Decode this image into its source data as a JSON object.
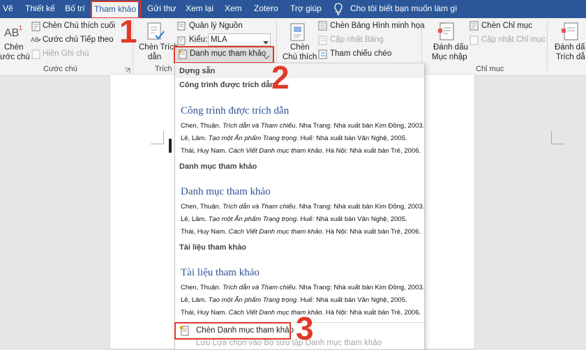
{
  "tabs": [
    "Vẽ",
    "Thiết kế",
    "Bố trí",
    "Tham khảo",
    "Gửi thư",
    "Xem lại",
    "Xem",
    "Zotero",
    "Trợ giúp"
  ],
  "tell_me": "Cho tôi biết bạn muốn làm gì",
  "ribbon": {
    "footnote_btn_line1": "Chèn",
    "footnote_btn_line2": "ước chú",
    "insert_endnote": "Chèn Chú thích cuối",
    "next_footnote": "Cước chú Tiếp theo",
    "show_notes": "Hiện Ghi chú",
    "footnotes_group": "Cước chú",
    "citation_btn_line1": "Chèn Trích",
    "citation_btn_line2": "dẫn",
    "citations_group": "Trích dẫ",
    "manage_sources": "Quản lý Nguồn",
    "style_label": "Kiểu:",
    "style_value": "MLA",
    "bibliography_btn": "Danh mục tham khảo",
    "caption_btn_line1": "Chèn",
    "caption_btn_line2": "Chú thích",
    "insert_table_of_figures": "Chèn Bảng Hình minh họa",
    "update_table": "Cập nhật Bảng",
    "cross_reference": "Tham chiếu chéo",
    "mark_entry_line1": "Đánh dấu",
    "mark_entry_line2": "Mục nhập",
    "insert_index": "Chèn Chỉ mục",
    "update_index": "Cập nhật Chỉ mục",
    "index_group": "Chỉ mục",
    "mark_citation_line1": "Đánh dấ",
    "mark_citation_line2": "Trích dẫ"
  },
  "gallery": {
    "builtin_header": "Dựng sẵn",
    "sections": [
      {
        "label": "Công trình được trích dẫn",
        "title": "Công trình được trích dẫn",
        "refs": [
          {
            "pre": "Chen, Thuận. ",
            "it": "Trích dẫn và Tham chiếu",
            "post": ". Nha Trang: Nhà xuất bản Kim Đồng, 2003."
          },
          {
            "pre": "Lê, Lâm. ",
            "it": "Tạo một Ấn phẩm Trang trọng",
            "post": ". Huế: Nhà xuất bản Văn Nghệ, 2005."
          },
          {
            "pre": "Thái, Huy Nam. ",
            "it": "Cách Viết Danh mục tham khảo",
            "post": ". Hà Nội: Nhà xuất bản Trẻ, 2006."
          }
        ]
      },
      {
        "label": "Danh mục tham khảo",
        "title": "Danh mục tham khảo",
        "refs": [
          {
            "pre": "Chen, Thuận. ",
            "it": "Trích dẫn và Tham chiếu",
            "post": ". Nha Trang: Nhà xuất bản Kim Đồng, 2003."
          },
          {
            "pre": "Lê, Lâm. ",
            "it": "Tạo một Ấn phẩm Trang trọng",
            "post": ". Huế: Nhà xuất bản Văn Nghệ, 2005."
          },
          {
            "pre": "Thái, Huy Nam. ",
            "it": "Cách Viết Danh mục tham khảo",
            "post": ". Hà Nội: Nhà xuất bản Trẻ, 2006."
          }
        ]
      },
      {
        "label": "Tài liệu tham khảo",
        "title": "Tài liệu tham khảo",
        "refs": [
          {
            "pre": "Chen, Thuận. ",
            "it": "Trích dẫn và Tham chiếu",
            "post": ". Nha Trang: Nhà xuất bản Kim Đồng, 2003."
          },
          {
            "pre": "Lê, Lâm. ",
            "it": "Tạo một Ấn phẩm Trang trọng",
            "post": ". Huế: Nhà xuất bản Văn Nghệ, 2005."
          },
          {
            "pre": "Thái, Huy Nam. ",
            "it": "Cách Viết Danh mục tham khảo",
            "post": ". Hà Nội: Nhà xuất bản Trẻ, 2006."
          }
        ]
      }
    ],
    "insert_bibliography": "Chèn Danh mục tham khảo",
    "save_selection": "Lưu Lựa chọn vào Bộ sưu tập Danh mục tham khảo"
  },
  "annotations": [
    "1",
    "2",
    "3"
  ],
  "colors": {
    "accent": "#2b579a",
    "annotation": "#e03a2a",
    "gallery_title": "#2e5395"
  }
}
